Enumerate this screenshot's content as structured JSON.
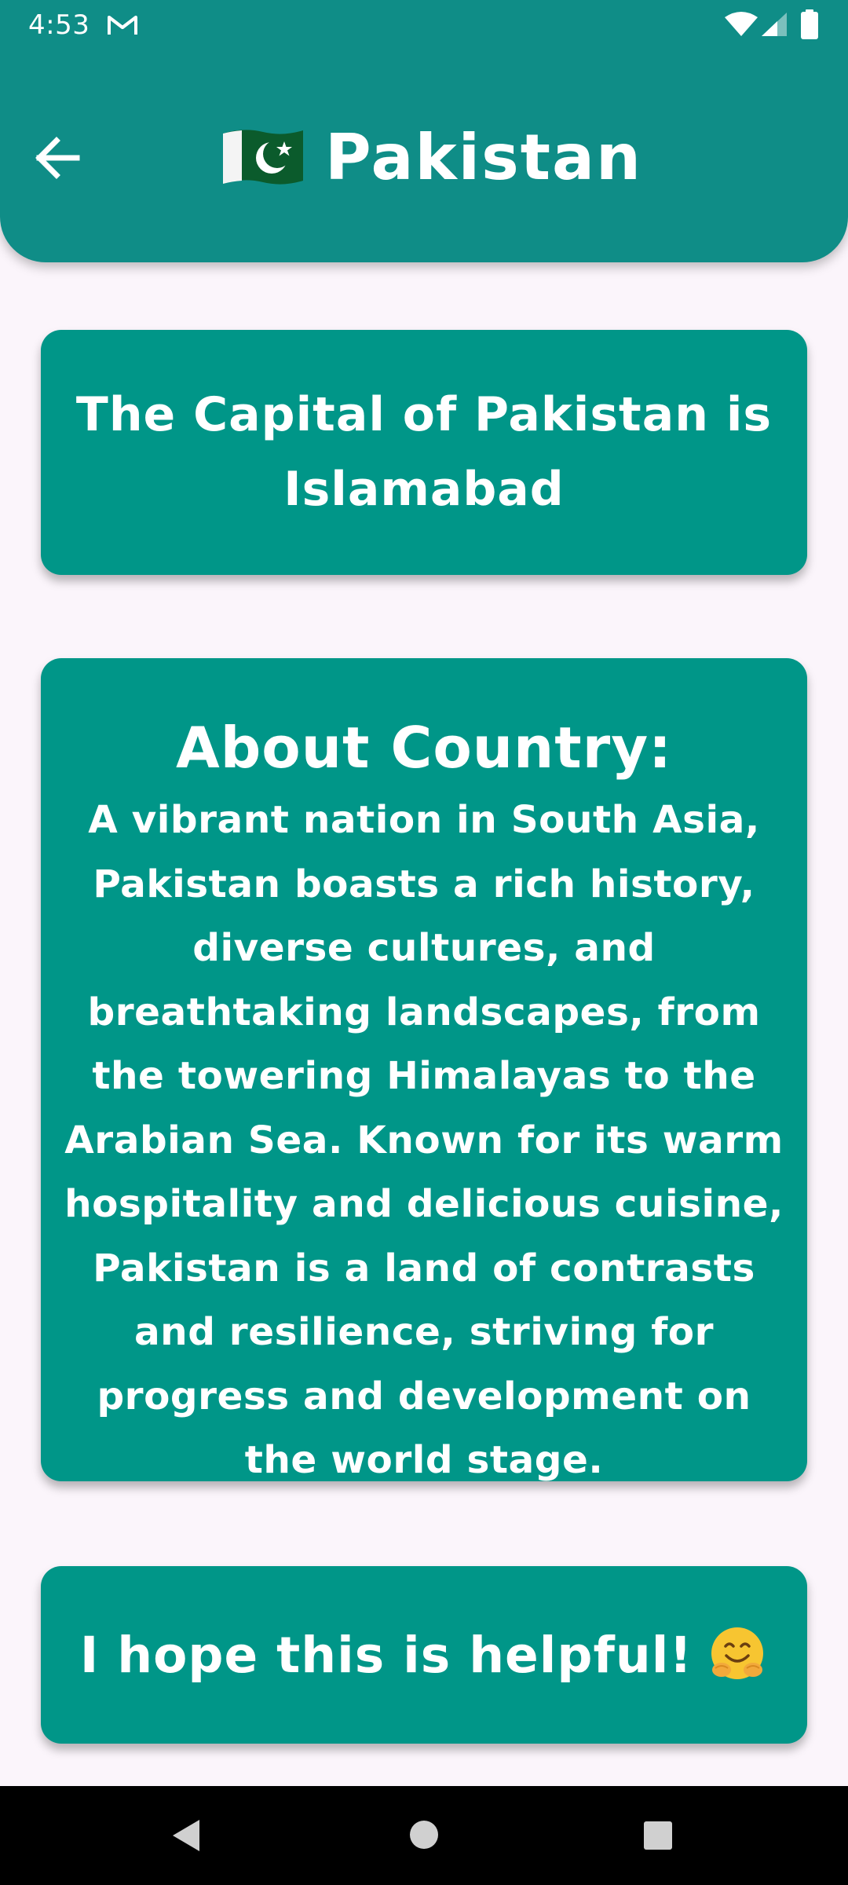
{
  "status_bar": {
    "time": "4:53",
    "icons": [
      "gmail-icon",
      "wifi-icon",
      "signal-icon",
      "battery-icon"
    ]
  },
  "header": {
    "back_icon": "arrow-left-icon",
    "flag_icon": "pakistan-flag-icon",
    "title": "Pakistan",
    "background_color": "#0f8d87"
  },
  "cards": {
    "capital": {
      "text": "The Capital of Pakistan is Islamabad"
    },
    "about": {
      "heading": "About Country:",
      "body": "A vibrant nation in South Asia, Pakistan boasts a rich history, diverse cultures, and breathtaking landscapes, from the towering Himalayas to the Arabian Sea. Known for its warm hospitality and delicious cuisine, Pakistan is a land of contrasts and resilience, striving for progress and development on the world stage."
    },
    "helpful": {
      "text": "I hope this is helpful!",
      "emoji_icon": "hugging-face-icon"
    },
    "card_color": "#009688"
  },
  "nav_bar": {
    "icons": [
      "nav-back-icon",
      "nav-home-icon",
      "nav-recents-icon"
    ]
  }
}
